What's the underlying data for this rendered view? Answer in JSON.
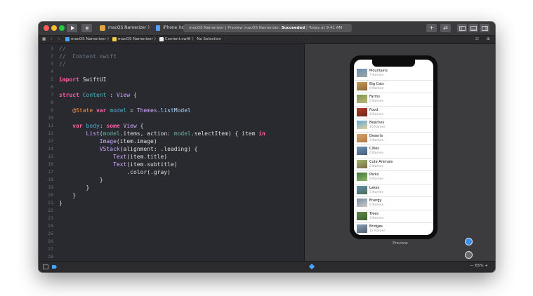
{
  "titlebar": {
    "scheme_app": "macOS Namerizer",
    "scheme_device": "iPhone Xs",
    "activity_prefix": "macOS Namerizer | Preview macOS Namerizer:",
    "activity_status": "Succeeded",
    "activity_time": "| Today at 9:41 AM"
  },
  "jumpbar": {
    "crumb_project": "macOS Namerizer",
    "crumb_folder": "macOS Namerizer",
    "crumb_file": "Content.swift",
    "crumb_selection": "No Selection"
  },
  "editor": {
    "line_numbers": [
      "1",
      "2",
      "3",
      "4",
      "5",
      "6",
      "7",
      "8",
      "9",
      "10",
      "11",
      "12",
      "13",
      "14",
      "15",
      "16",
      "17",
      "18",
      "19",
      "20",
      "21",
      "22",
      "23",
      "24",
      "25",
      "26",
      "27",
      "28"
    ],
    "code": {
      "l1": "//",
      "l2": "//  Content.swift",
      "l3": "//",
      "l5_kw": "import",
      "l5_rest": " SwiftUI",
      "l7_kw": "struct",
      "l7_name": " Content",
      "l7_sep": " : ",
      "l7_type": "View",
      "l7_end": " {",
      "l9_attr": "@State",
      "l9_kw": " var",
      "l9_name": " model",
      "l9_eq": " = ",
      "l9_type": "Themes",
      "l9_prop": ".listModel",
      "l11_kw": "var",
      "l11_name": " body",
      "l11_sep": ": ",
      "l11_some": "some",
      "l11_type": " View",
      "l11_end": " {",
      "l12_type": "List",
      "l12_a": "(",
      "l12_model": "model",
      "l12_b": ".items, action: ",
      "l12_model2": "model",
      "l12_c": ".selectItem) { item ",
      "l12_in": "in",
      "l13_type": "Image",
      "l13_rest": "(item.image)",
      "l14_type": "VStack",
      "l14_rest": "(alignment: .leading) {",
      "l15_type": "Text",
      "l15_rest": "(item.title)",
      "l16_type": "Text",
      "l16_rest": "(item.subtitle)",
      "l17_rest": ".color(.gray)",
      "l18": "}",
      "l19": "}",
      "l20": "}",
      "l21": "}"
    }
  },
  "preview": {
    "label": "Preview",
    "zoom": "65%",
    "rows": [
      {
        "title": "Mountains",
        "subtitle": "7 Names"
      },
      {
        "title": "Big Cats",
        "subtitle": "9 Names"
      },
      {
        "title": "Farms",
        "subtitle": "5 Names"
      },
      {
        "title": "Food",
        "subtitle": "4 Names"
      },
      {
        "title": "Beaches",
        "subtitle": "10 Names"
      },
      {
        "title": "Deserts",
        "subtitle": "3 Names"
      },
      {
        "title": "Cities",
        "subtitle": "6 Names"
      },
      {
        "title": "Cute Animals",
        "subtitle": "5 Names"
      },
      {
        "title": "Parks",
        "subtitle": "9 Names"
      },
      {
        "title": "Lakes",
        "subtitle": "5 Names"
      },
      {
        "title": "Energy",
        "subtitle": "6 Names"
      },
      {
        "title": "Trees",
        "subtitle": "3 Names"
      },
      {
        "title": "Bridges",
        "subtitle": "12 Names"
      }
    ]
  },
  "colors": {
    "keyword": "#fc5fa3",
    "comment": "#6c7986",
    "type": "#d0a8ff",
    "accent": "#3a8ee6"
  }
}
